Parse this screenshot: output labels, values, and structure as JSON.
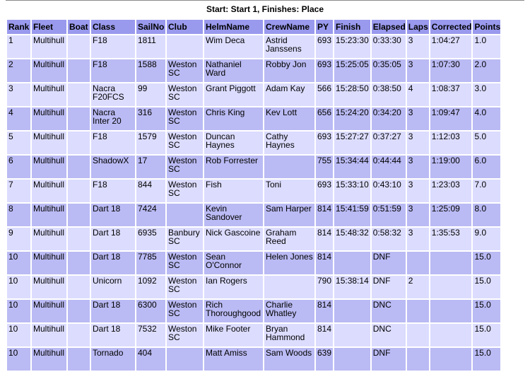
{
  "caption": "Start: Start 1, Finishes: Place",
  "columns": [
    "Rank",
    "Fleet",
    "Boat",
    "Class",
    "SailNo",
    "Club",
    "HelmName",
    "CrewName",
    "PY",
    "Finish",
    "Elapsed",
    "Laps",
    "Corrected",
    "Points"
  ],
  "rows": [
    [
      "1",
      "Multihull",
      "",
      "F18",
      "1811",
      "",
      "Wim Deca",
      "Astrid Janssens",
      "693",
      "15:23:30",
      "0:33:30",
      "3",
      "1:04:27",
      "1.0"
    ],
    [
      "2",
      "Multihull",
      "",
      "F18",
      "1588",
      "Weston SC",
      "Nathaniel Ward",
      "Robby Jon",
      "693",
      "15:25:05",
      "0:35:05",
      "3",
      "1:07:30",
      "2.0"
    ],
    [
      "3",
      "Multihull",
      "",
      "Nacra F20FCS",
      "99",
      "Weston SC",
      "Grant Piggott",
      "Adam Kay",
      "566",
      "15:28:50",
      "0:38:50",
      "4",
      "1:08:37",
      "3.0"
    ],
    [
      "4",
      "Multihull",
      "",
      "Nacra Inter 20",
      "316",
      "Weston SC",
      "Chris King",
      "Kev Lott",
      "656",
      "15:24:20",
      "0:34:20",
      "3",
      "1:09:47",
      "4.0"
    ],
    [
      "5",
      "Multihull",
      "",
      "F18",
      "1579",
      "Weston SC",
      "Duncan Haynes",
      "Cathy Haynes",
      "693",
      "15:27:27",
      "0:37:27",
      "3",
      "1:12:03",
      "5.0"
    ],
    [
      "6",
      "Multihull",
      "",
      "ShadowX",
      "17",
      "Weston SC",
      "Rob Forrester",
      "",
      "755",
      "15:34:44",
      "0:44:44",
      "3",
      "1:19:00",
      "6.0"
    ],
    [
      "7",
      "Multihull",
      "",
      "F18",
      "844",
      "Weston SC",
      "Fish",
      "Toni",
      "693",
      "15:33:10",
      "0:43:10",
      "3",
      "1:23:03",
      "7.0"
    ],
    [
      "8",
      "Multihull",
      "",
      "Dart 18",
      "7424",
      "",
      "Kevin Sandover",
      "Sam Harper",
      "814",
      "15:41:59",
      "0:51:59",
      "3",
      "1:25:09",
      "8.0"
    ],
    [
      "9",
      "Multihull",
      "",
      "Dart 18",
      "6935",
      "Banbury SC",
      "Nick Gascoine",
      "Graham Reed",
      "814",
      "15:48:32",
      "0:58:32",
      "3",
      "1:35:53",
      "9.0"
    ],
    [
      "10",
      "Multihull",
      "",
      "Dart 18",
      "7785",
      "Weston SC",
      "Sean O'Connor",
      "Helen Jones",
      "814",
      "",
      "DNF",
      "",
      "",
      "15.0"
    ],
    [
      "10",
      "Multihull",
      "",
      "Unicorn",
      "1092",
      "Weston SC",
      "Ian Rogers",
      "",
      "790",
      "15:38:14",
      "DNF",
      "2",
      "",
      "15.0"
    ],
    [
      "10",
      "Multihull",
      "",
      "Dart 18",
      "6300",
      "Weston SC",
      "Rich Thoroughgood",
      "Charlie Whatley",
      "814",
      "",
      "DNC",
      "",
      "",
      "15.0"
    ],
    [
      "10",
      "Multihull",
      "",
      "Dart 18",
      "7532",
      "Weston SC",
      "Mike Footer",
      "Bryan Hammond",
      "814",
      "",
      "DNC",
      "",
      "",
      "15.0"
    ],
    [
      "10",
      "Multihull",
      "",
      "Tornado",
      "404",
      "",
      "Matt Amiss",
      "Sam Woods",
      "639",
      "",
      "DNF",
      "",
      "",
      "15.0"
    ]
  ]
}
